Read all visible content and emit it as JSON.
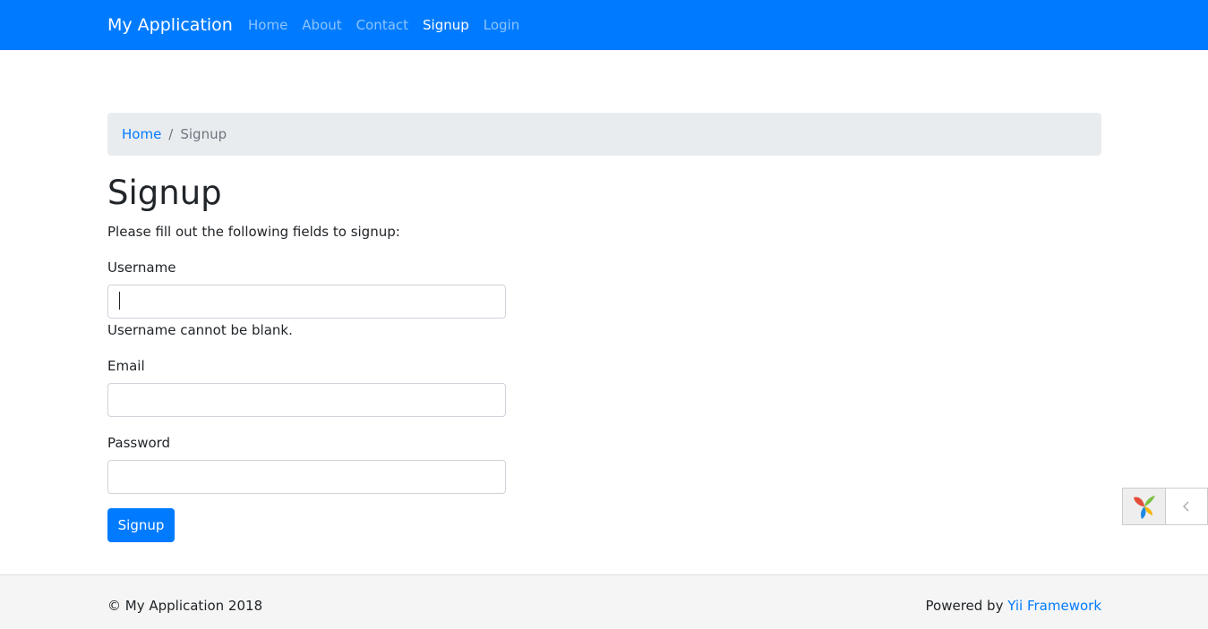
{
  "navbar": {
    "brand": "My Application",
    "items": [
      {
        "label": "Home",
        "active": false
      },
      {
        "label": "About",
        "active": false
      },
      {
        "label": "Contact",
        "active": false
      },
      {
        "label": "Signup",
        "active": true
      },
      {
        "label": "Login",
        "active": false
      }
    ]
  },
  "breadcrumb": {
    "home": "Home",
    "separator": "/",
    "current": "Signup"
  },
  "page": {
    "title": "Signup",
    "intro": "Please fill out the following fields to signup:"
  },
  "form": {
    "username": {
      "label": "Username",
      "value": "",
      "error": "Username cannot be blank."
    },
    "email": {
      "label": "Email",
      "value": ""
    },
    "password": {
      "label": "Password",
      "value": ""
    },
    "submit_label": "Signup"
  },
  "footer": {
    "copyright": "© My Application 2018",
    "powered_prefix": "Powered by ",
    "powered_link": "Yii Framework"
  },
  "colors": {
    "primary": "#007bff",
    "breadcrumb_bg": "#e9ecef",
    "footer_bg": "#f5f5f5"
  },
  "debug_toolbar": {
    "logo_icon": "yii-logo-icon",
    "toggle_icon": "chevron-left-icon"
  }
}
